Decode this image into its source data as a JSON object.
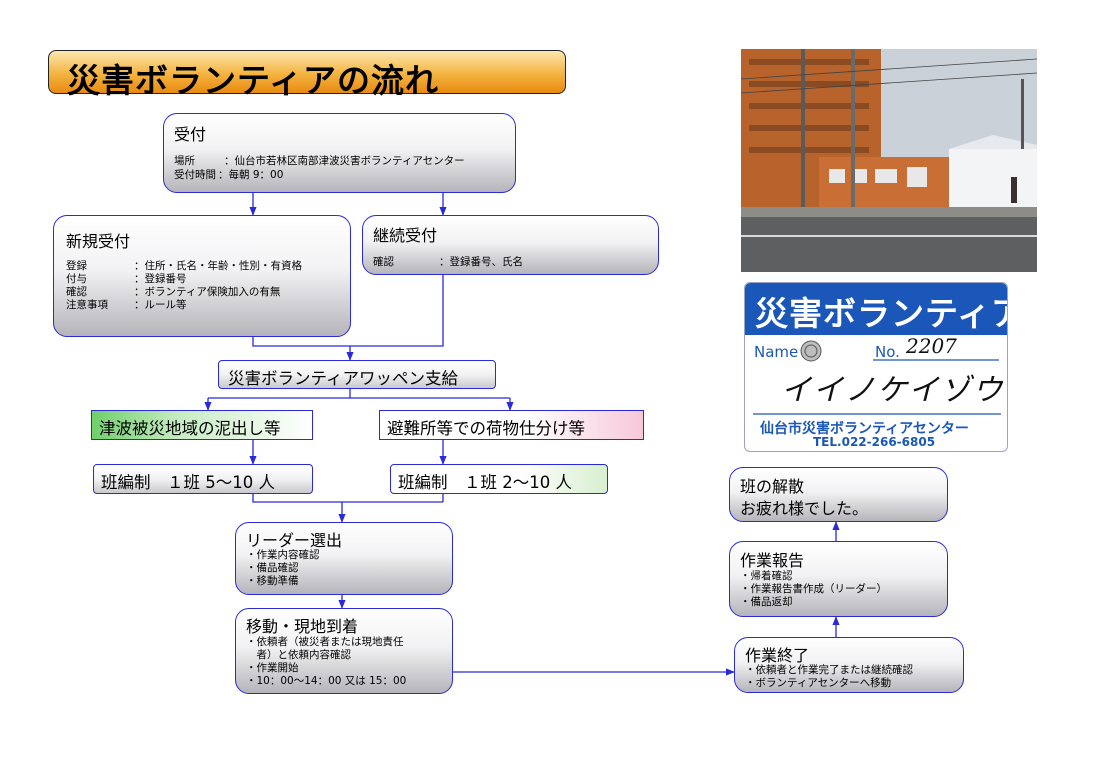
{
  "title": "災害ボランティアの流れ",
  "reception": {
    "heading": "受付",
    "rows": [
      {
        "key": "場所",
        "value": "：仙台市若林区南部津波災害ボランティアセンター"
      },
      {
        "key": "受付時間",
        "value": "：毎朝 9：00"
      }
    ]
  },
  "new_reception": {
    "heading": "新規受付",
    "rows": [
      {
        "key": "登録",
        "value": "：住所・氏名・年齢・性別・有資格"
      },
      {
        "key": "付与",
        "value": "：登録番号"
      },
      {
        "key": "確認",
        "value": "：ボランティア保険加入の有無"
      },
      {
        "key": "注意事項",
        "value": "：ルール等"
      }
    ]
  },
  "continuing_reception": {
    "heading": "継続受付",
    "rows": [
      {
        "key": "確認",
        "value": "：登録番号、氏名"
      }
    ]
  },
  "patch": {
    "label": "災害ボランティアワッペン支給"
  },
  "task_left": {
    "label": "津波被災地域の泥出し等"
  },
  "task_right": {
    "label": "避難所等での荷物仕分け等"
  },
  "team_left": {
    "label": "班編制　１班 5～10 人"
  },
  "team_right": {
    "label": "班編制　１班 2～10 人"
  },
  "leader": {
    "heading": "リーダー選出",
    "items": [
      "・作業内容確認",
      "・備品確認",
      "・移動準備"
    ]
  },
  "move": {
    "heading": "移動・現地到着",
    "items": [
      "・依頼者（被災者または現地責任",
      "　者）と依頼内容確認",
      "・作業開始",
      "・10：00～14：00 又は 15：00"
    ]
  },
  "end": {
    "heading": "作業終了",
    "items": [
      "・依頼者と作業完了または継続確認",
      "・ボランティアセンターへ移動"
    ]
  },
  "report": {
    "heading": "作業報告",
    "items": [
      "・帰着確認",
      "・作業報告書作成（リーダー）",
      "・備品返却"
    ]
  },
  "dismiss": {
    "heading": "班の解散",
    "sub": "お疲れ様でした。"
  },
  "badge": {
    "title": "災害ボランティア",
    "name_label": "Name",
    "no_label": "No.",
    "no_value": "2207",
    "handwritten": "イイノケイゾウ",
    "center": "仙台市災害ボランティアセンター",
    "tel": "TEL.022-266-6805"
  },
  "colors": {
    "line": "#2a2ad8",
    "title_orange": "#f4b340",
    "badge_blue": "#1b57b8"
  }
}
